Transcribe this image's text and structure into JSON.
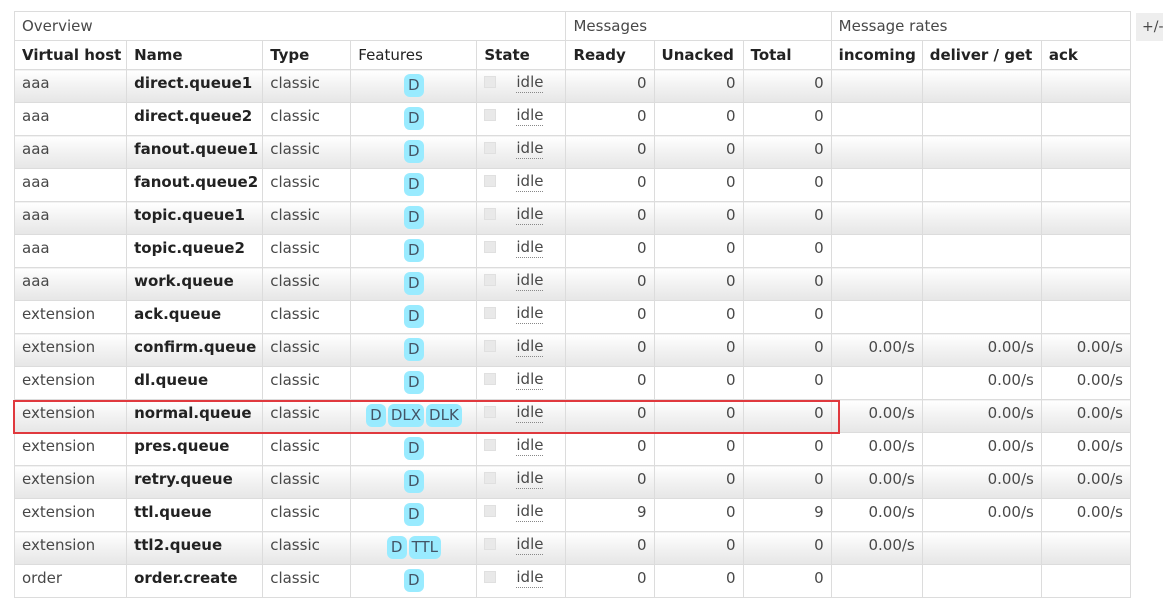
{
  "groups": {
    "overview": "Overview",
    "messages": "Messages",
    "message_rates": "Message rates"
  },
  "toggle_label": "+/-",
  "columns": {
    "virtual_host": "Virtual host",
    "name": "Name",
    "type": "Type",
    "features": "Features",
    "state": "State",
    "ready": "Ready",
    "unacked": "Unacked",
    "total": "Total",
    "incoming": "incoming",
    "deliver_get": "deliver / get",
    "ack": "ack"
  },
  "highlight_color": "#e0393e",
  "badge_color": "#99ebff",
  "queues": [
    {
      "vhost": "aaa",
      "name": "direct.queue1",
      "type": "classic",
      "features": [
        "D"
      ],
      "state": "idle",
      "ready": "0",
      "unacked": "0",
      "total": "0",
      "incoming": "",
      "deliver": "",
      "ack": ""
    },
    {
      "vhost": "aaa",
      "name": "direct.queue2",
      "type": "classic",
      "features": [
        "D"
      ],
      "state": "idle",
      "ready": "0",
      "unacked": "0",
      "total": "0",
      "incoming": "",
      "deliver": "",
      "ack": ""
    },
    {
      "vhost": "aaa",
      "name": "fanout.queue1",
      "type": "classic",
      "features": [
        "D"
      ],
      "state": "idle",
      "ready": "0",
      "unacked": "0",
      "total": "0",
      "incoming": "",
      "deliver": "",
      "ack": ""
    },
    {
      "vhost": "aaa",
      "name": "fanout.queue2",
      "type": "classic",
      "features": [
        "D"
      ],
      "state": "idle",
      "ready": "0",
      "unacked": "0",
      "total": "0",
      "incoming": "",
      "deliver": "",
      "ack": ""
    },
    {
      "vhost": "aaa",
      "name": "topic.queue1",
      "type": "classic",
      "features": [
        "D"
      ],
      "state": "idle",
      "ready": "0",
      "unacked": "0",
      "total": "0",
      "incoming": "",
      "deliver": "",
      "ack": ""
    },
    {
      "vhost": "aaa",
      "name": "topic.queue2",
      "type": "classic",
      "features": [
        "D"
      ],
      "state": "idle",
      "ready": "0",
      "unacked": "0",
      "total": "0",
      "incoming": "",
      "deliver": "",
      "ack": ""
    },
    {
      "vhost": "aaa",
      "name": "work.queue",
      "type": "classic",
      "features": [
        "D"
      ],
      "state": "idle",
      "ready": "0",
      "unacked": "0",
      "total": "0",
      "incoming": "",
      "deliver": "",
      "ack": ""
    },
    {
      "vhost": "extension",
      "name": "ack.queue",
      "type": "classic",
      "features": [
        "D"
      ],
      "state": "idle",
      "ready": "0",
      "unacked": "0",
      "total": "0",
      "incoming": "",
      "deliver": "",
      "ack": ""
    },
    {
      "vhost": "extension",
      "name": "confirm.queue",
      "type": "classic",
      "features": [
        "D"
      ],
      "state": "idle",
      "ready": "0",
      "unacked": "0",
      "total": "0",
      "incoming": "0.00/s",
      "deliver": "0.00/s",
      "ack": "0.00/s"
    },
    {
      "vhost": "extension",
      "name": "dl.queue",
      "type": "classic",
      "features": [
        "D"
      ],
      "state": "idle",
      "ready": "0",
      "unacked": "0",
      "total": "0",
      "incoming": "",
      "deliver": "0.00/s",
      "ack": "0.00/s"
    },
    {
      "vhost": "extension",
      "name": "normal.queue",
      "type": "classic",
      "features": [
        "D",
        "DLX",
        "DLK"
      ],
      "state": "idle",
      "ready": "0",
      "unacked": "0",
      "total": "0",
      "incoming": "0.00/s",
      "deliver": "0.00/s",
      "ack": "0.00/s"
    },
    {
      "vhost": "extension",
      "name": "pres.queue",
      "type": "classic",
      "features": [
        "D"
      ],
      "state": "idle",
      "ready": "0",
      "unacked": "0",
      "total": "0",
      "incoming": "0.00/s",
      "deliver": "0.00/s",
      "ack": "0.00/s"
    },
    {
      "vhost": "extension",
      "name": "retry.queue",
      "type": "classic",
      "features": [
        "D"
      ],
      "state": "idle",
      "ready": "0",
      "unacked": "0",
      "total": "0",
      "incoming": "0.00/s",
      "deliver": "0.00/s",
      "ack": "0.00/s"
    },
    {
      "vhost": "extension",
      "name": "ttl.queue",
      "type": "classic",
      "features": [
        "D"
      ],
      "state": "idle",
      "ready": "9",
      "unacked": "0",
      "total": "9",
      "incoming": "0.00/s",
      "deliver": "0.00/s",
      "ack": "0.00/s"
    },
    {
      "vhost": "extension",
      "name": "ttl2.queue",
      "type": "classic",
      "features": [
        "D",
        "TTL"
      ],
      "state": "idle",
      "ready": "0",
      "unacked": "0",
      "total": "0",
      "incoming": "0.00/s",
      "deliver": "",
      "ack": ""
    },
    {
      "vhost": "order",
      "name": "order.create",
      "type": "classic",
      "features": [
        "D"
      ],
      "state": "idle",
      "ready": "0",
      "unacked": "0",
      "total": "0",
      "incoming": "",
      "deliver": "",
      "ack": ""
    }
  ]
}
